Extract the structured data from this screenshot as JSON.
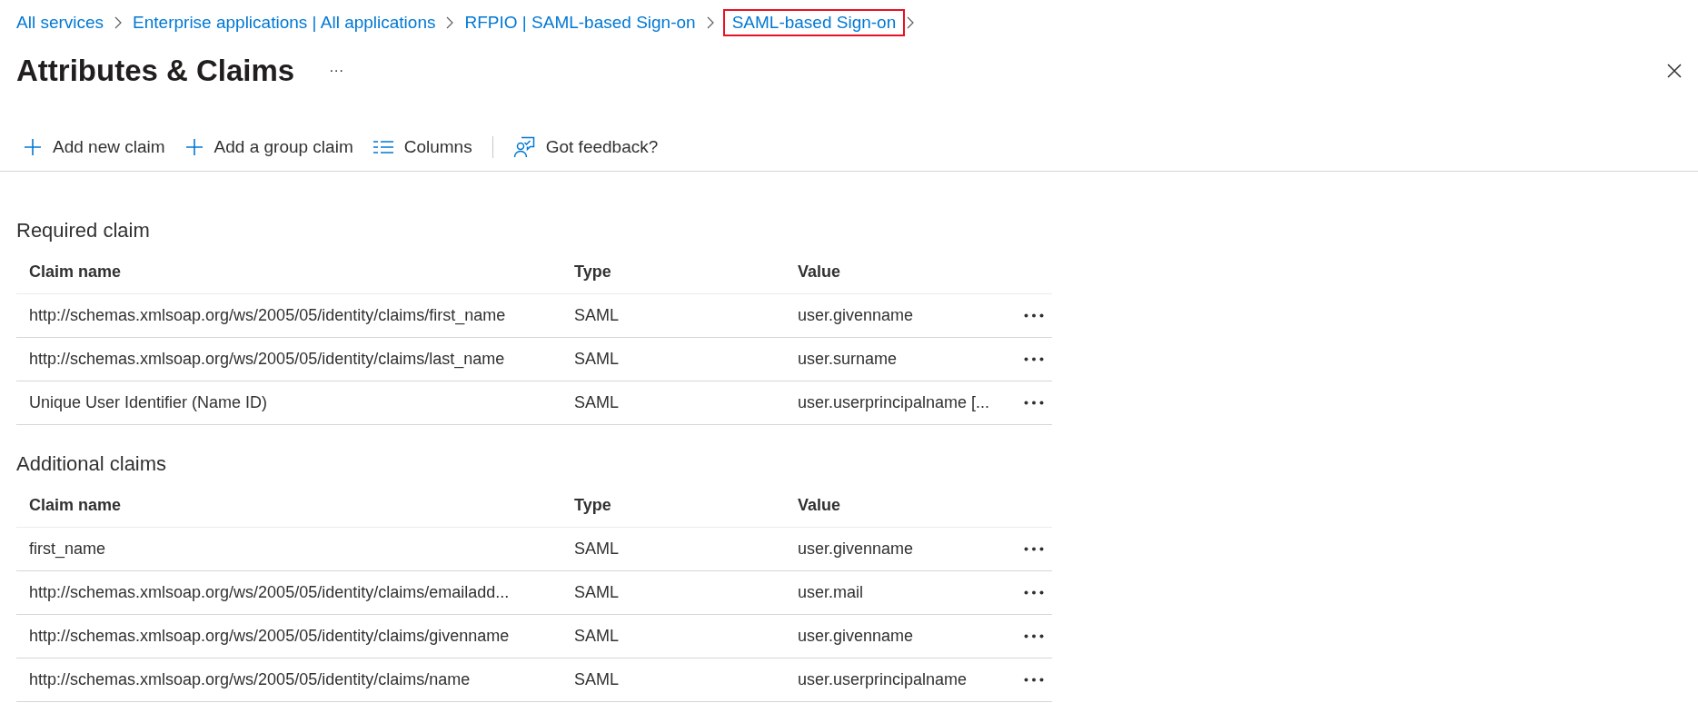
{
  "breadcrumbs": [
    {
      "label": "All services",
      "highlighted": false
    },
    {
      "label": "Enterprise applications | All applications",
      "highlighted": false
    },
    {
      "label": "RFPIO | SAML-based Sign-on",
      "highlighted": false
    },
    {
      "label": "SAML-based Sign-on",
      "highlighted": true
    }
  ],
  "page": {
    "title": "Attributes & Claims",
    "more": "···"
  },
  "toolbar": {
    "items": [
      {
        "kind": "add",
        "label": "Add new claim"
      },
      {
        "kind": "add",
        "label": "Add a group claim"
      },
      {
        "kind": "columns",
        "label": "Columns"
      }
    ],
    "secondary": [
      {
        "kind": "feedback",
        "label": "Got feedback?"
      }
    ]
  },
  "sections": [
    {
      "title": "Required claim",
      "columns": [
        "Claim name",
        "Type",
        "Value"
      ],
      "rows": [
        {
          "name": "http://schemas.xmlsoap.org/ws/2005/05/identity/claims/first_name",
          "type": "SAML",
          "value": "user.givenname"
        },
        {
          "name": "http://schemas.xmlsoap.org/ws/2005/05/identity/claims/last_name",
          "type": "SAML",
          "value": "user.surname"
        },
        {
          "name": "Unique User Identifier (Name ID)",
          "type": "SAML",
          "value": "user.userprincipalname [..."
        }
      ]
    },
    {
      "title": "Additional claims",
      "columns": [
        "Claim name",
        "Type",
        "Value"
      ],
      "rows": [
        {
          "name": "first_name",
          "type": "SAML",
          "value": "user.givenname"
        },
        {
          "name": "http://schemas.xmlsoap.org/ws/2005/05/identity/claims/emailadd...",
          "type": "SAML",
          "value": "user.mail"
        },
        {
          "name": "http://schemas.xmlsoap.org/ws/2005/05/identity/claims/givenname",
          "type": "SAML",
          "value": "user.givenname"
        },
        {
          "name": "http://schemas.xmlsoap.org/ws/2005/05/identity/claims/name",
          "type": "SAML",
          "value": "user.userprincipalname"
        }
      ]
    }
  ]
}
